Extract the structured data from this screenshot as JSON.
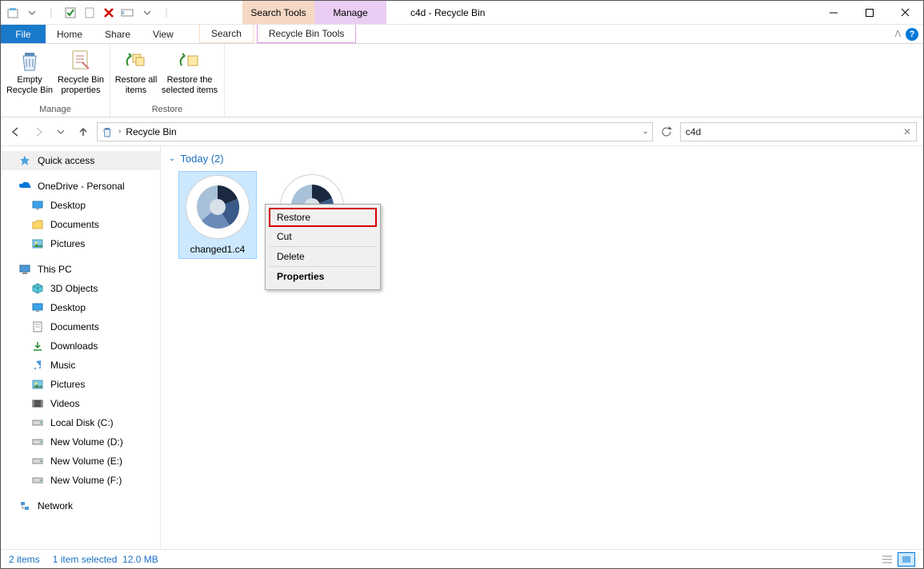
{
  "window": {
    "title": "c4d - Recycle Bin",
    "ctx_tabs": {
      "search": "Search Tools",
      "manage": "Manage"
    }
  },
  "menubar": {
    "file": "File",
    "home": "Home",
    "share": "Share",
    "view": "View",
    "search": "Search",
    "rbt": "Recycle Bin Tools"
  },
  "ribbon": {
    "empty": "Empty Recycle Bin",
    "props": "Recycle Bin properties",
    "restore_all": "Restore all items",
    "restore_sel": "Restore the selected items",
    "group_manage": "Manage",
    "group_restore": "Restore"
  },
  "address": {
    "location": "Recycle Bin",
    "search_value": "c4d"
  },
  "sidebar": {
    "quick_access": "Quick access",
    "onedrive": "OneDrive - Personal",
    "desktop": "Desktop",
    "documents": "Documents",
    "pictures": "Pictures",
    "this_pc": "This PC",
    "objects3d": "3D Objects",
    "desktop2": "Desktop",
    "documents2": "Documents",
    "downloads": "Downloads",
    "music": "Music",
    "pictures2": "Pictures",
    "videos": "Videos",
    "localc": "Local Disk (C:)",
    "vold": "New Volume (D:)",
    "vole": "New Volume (E:)",
    "volf": "New Volume (F:)",
    "network": "Network"
  },
  "content": {
    "group": "Today (2)",
    "file1": "changed1.c4",
    "file2": ""
  },
  "context_menu": {
    "restore": "Restore",
    "cut": "Cut",
    "delete": "Delete",
    "properties": "Properties"
  },
  "status": {
    "count": "2 items",
    "selection": "1 item selected",
    "size": "12.0 MB"
  }
}
